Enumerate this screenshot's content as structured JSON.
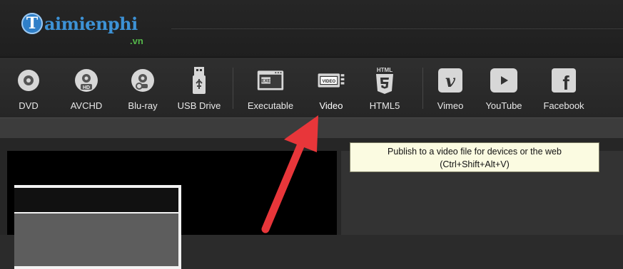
{
  "brand": {
    "badge": "T",
    "word": "aimienphi",
    "tld": ".vn"
  },
  "toolbar": {
    "items": [
      {
        "label": "DVD",
        "icon": "disc-icon"
      },
      {
        "label": "AVCHD",
        "icon": "hd-disc-icon"
      },
      {
        "label": "Blu-ray",
        "icon": "bluray-disc-icon"
      },
      {
        "label": "USB Drive",
        "icon": "usb-drive-icon"
      },
      {
        "label": "Executable",
        "icon": "executable-icon",
        "icon_text": "EXE"
      },
      {
        "label": "Video",
        "icon": "video-file-icon",
        "icon_text": "VIDEO"
      },
      {
        "label": "HTML5",
        "icon": "html5-icon",
        "icon_text": "HTML"
      },
      {
        "label": "Vimeo",
        "icon": "vimeo-icon"
      },
      {
        "label": "YouTube",
        "icon": "youtube-icon"
      },
      {
        "label": "Facebook",
        "icon": "facebook-icon"
      }
    ]
  },
  "tooltip": {
    "line1": "Publish to a video file for devices or the web",
    "line2": "(Ctrl+Shift+Alt+V)"
  },
  "colors": {
    "accent_arrow": "#e8363a",
    "tooltip_bg": "#fbfbe1",
    "brand_blue": "#3d92d6",
    "brand_green": "#55b84a"
  }
}
